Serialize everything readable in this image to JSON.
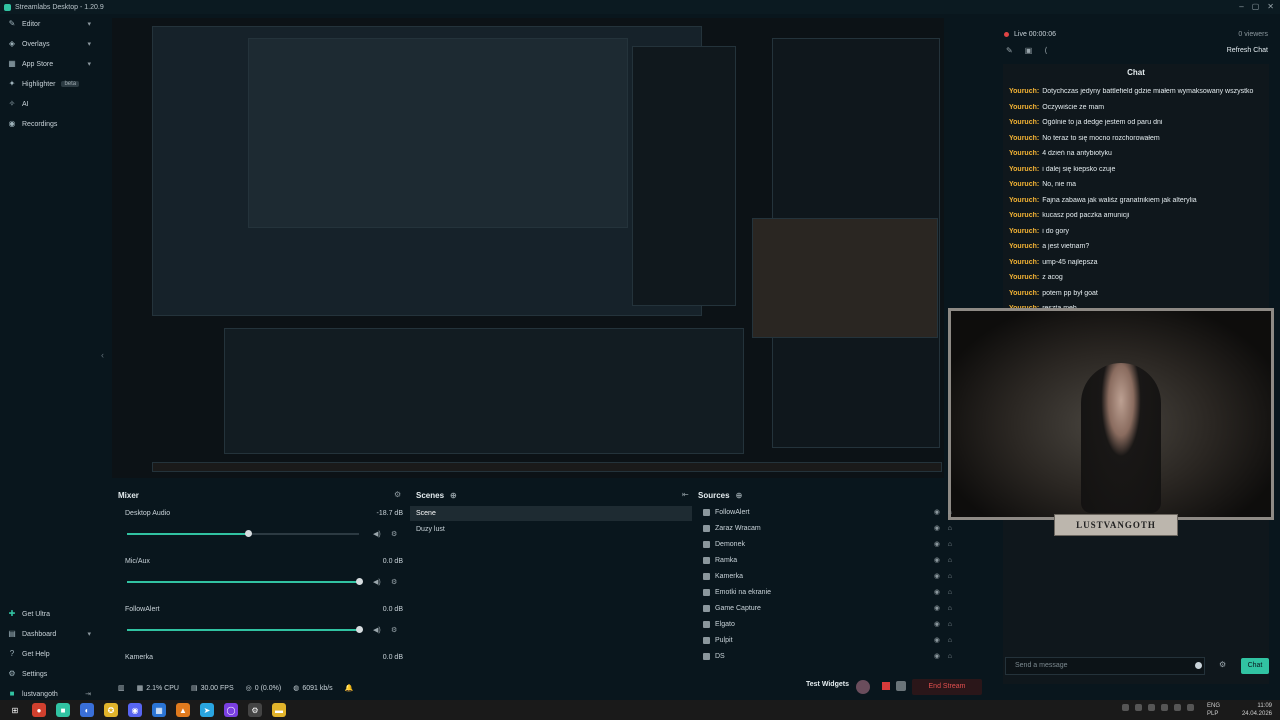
{
  "titlebar": {
    "title": "Streamlabs Desktop - 1.20.9"
  },
  "sidebar": {
    "items": [
      {
        "label": "Editor",
        "icon": "edit-icon"
      },
      {
        "label": "Overlays",
        "icon": "overlays-icon"
      },
      {
        "label": "App Store",
        "icon": "app-store-icon"
      },
      {
        "label": "Highlighter",
        "icon": "highlighter-icon",
        "badge": "beta"
      },
      {
        "label": "AI",
        "icon": "ai-icon"
      },
      {
        "label": "Recordings",
        "icon": "recordings-icon"
      }
    ],
    "bottom": [
      {
        "label": "Get Ultra",
        "icon": "ultra-icon"
      },
      {
        "label": "Dashboard",
        "icon": "dashboard-icon"
      },
      {
        "label": "Get Help",
        "icon": "help-icon"
      },
      {
        "label": "Settings",
        "icon": "gear-icon"
      },
      {
        "label": "lustvangoth",
        "icon": "profile-icon"
      }
    ]
  },
  "live_header": {
    "live_text": "Live 00:00:06",
    "viewers": "0 viewers",
    "refresh_chat": "Refresh Chat"
  },
  "chat": {
    "title": "Chat",
    "messages": [
      {
        "user": "Youruch:",
        "text": "Dotychczas jedyny battlefield gdzie miałem wymaksowany wszystko"
      },
      {
        "user": "Youruch:",
        "text": "Oczywiście że mam"
      },
      {
        "user": "Youruch:",
        "text": "Ogólnie to ja dedge jestem od paru dni"
      },
      {
        "user": "Youruch:",
        "text": "No teraz to się mocno rozchorowałem"
      },
      {
        "user": "Youruch:",
        "text": "4 dzień na antybiotyku"
      },
      {
        "user": "Youruch:",
        "text": "i dalej się kiepsko czuje"
      },
      {
        "user": "Youruch:",
        "text": "No, nie ma"
      },
      {
        "user": "Youruch:",
        "text": "Fajna zabawa jak waliśz granatnikiem jak alterylia"
      },
      {
        "user": "Youruch:",
        "text": "kucasz pod paczka amunicji"
      },
      {
        "user": "Youruch:",
        "text": "i do gory"
      },
      {
        "user": "Youruch:",
        "text": "a jest vietnam?"
      },
      {
        "user": "Youruch:",
        "text": "ump-45 najlepsza"
      },
      {
        "user": "Youruch:",
        "text": "z acog"
      },
      {
        "user": "Youruch:",
        "text": "potem pp był goat"
      },
      {
        "user": "Youruch:",
        "text": "reszta meh"
      }
    ],
    "send_placeholder": "Send a message",
    "send_button": "Chat"
  },
  "overlay_logo": "LUSTVANGOTH",
  "mixer": {
    "title": "Mixer",
    "rows": [
      {
        "name": "Desktop Audio",
        "db": "-18.7 dB",
        "level": 0.52
      },
      {
        "name": "Mic/Aux",
        "db": "0.0 dB",
        "level": 1.0
      },
      {
        "name": "FollowAlert",
        "db": "0.0 dB",
        "level": 1.0
      },
      {
        "name": "Kamerka",
        "db": "0.0 dB",
        "level": 1.0
      }
    ]
  },
  "scenes": {
    "title": "Scenes",
    "items": [
      {
        "label": "Scene",
        "active": true
      },
      {
        "label": "Duzy lust",
        "active": false
      }
    ]
  },
  "sources": {
    "title": "Sources",
    "items": [
      "FollowAlert",
      "Zaraz Wracam",
      "Demonek",
      "Ramka",
      "Kamerka",
      "Emotki na ekranie",
      "Game Capture",
      "Elgato",
      "Pulpit",
      "DS"
    ]
  },
  "statusbar": {
    "cpu": "2.1% CPU",
    "fps": "30.00 FPS",
    "dropped": "0 (0.0%)",
    "bitrate": "6091 kb/s",
    "test_widgets": "Test Widgets",
    "end_stream": "End Stream"
  },
  "taskbar": {
    "lang": "ENG",
    "lang2": "PLP",
    "time": "11:09",
    "date": "24.04.2026"
  },
  "colors": {
    "accent": "#31c3a2",
    "live_red": "#e04444",
    "chat_user": "#f2b234",
    "end_stream": "#e24f4f"
  }
}
